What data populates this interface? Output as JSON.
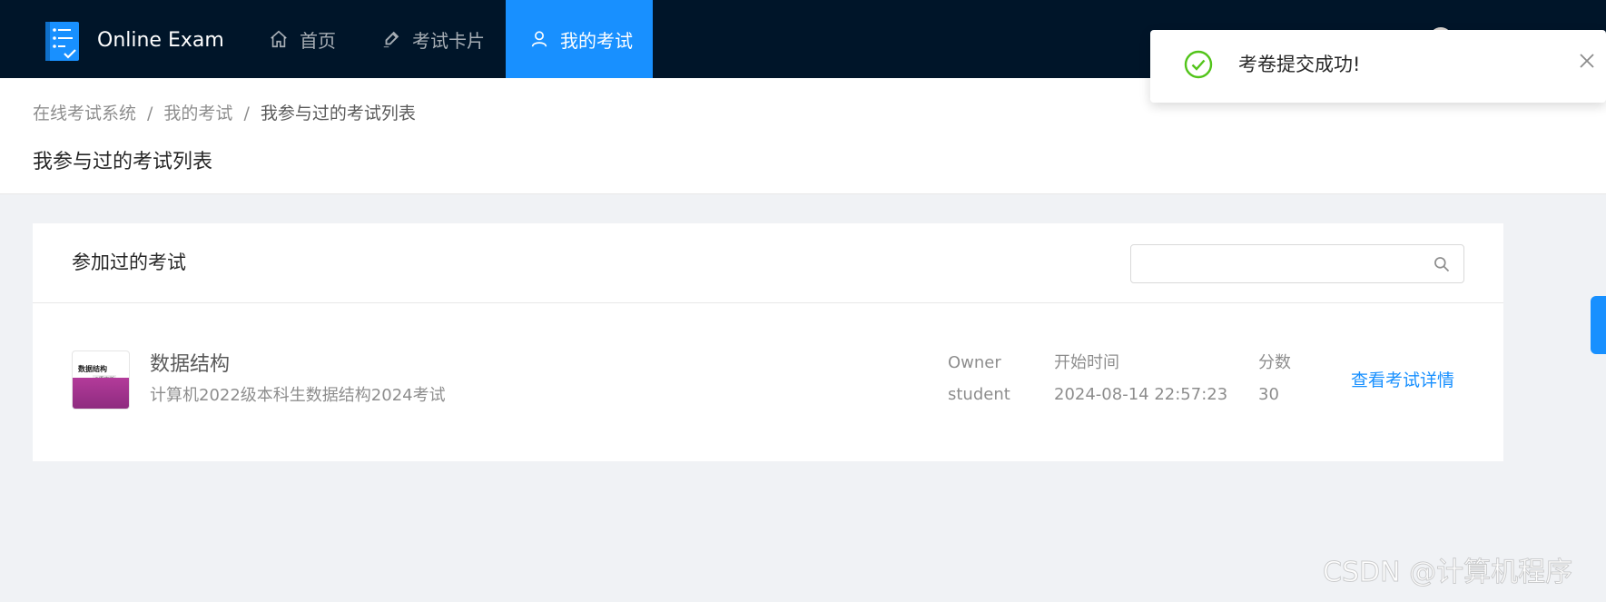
{
  "header": {
    "brand": "Online Exam",
    "nav": [
      {
        "label": "首页",
        "icon": "home-icon"
      },
      {
        "label": "考试卡片",
        "icon": "edit-icon"
      },
      {
        "label": "我的考试",
        "icon": "user-icon",
        "active": true
      }
    ],
    "colors": {
      "bg": "#001529",
      "active": "#1890ff"
    }
  },
  "page_header": {
    "breadcrumb": [
      "在线考试系统",
      "我的考试",
      "我参与过的考试列表"
    ],
    "separator": "/",
    "title": "我参与过的考试列表"
  },
  "card": {
    "title": "参加过的考试",
    "search": {
      "value": "",
      "placeholder": ""
    },
    "items": [
      {
        "title": "数据结构",
        "description": "计算机2022级本科生数据结构2024考试",
        "owner_label": "Owner",
        "owner": "student",
        "time_label": "开始时间",
        "time": "2024-08-14 22:57:23",
        "score_label": "分数",
        "score": "30",
        "action": "查看考试详情",
        "cover": {
          "title": "数据结构",
          "tag": "C语言版"
        }
      }
    ]
  },
  "notification": {
    "type": "success",
    "message": "考卷提交成功!",
    "color": "#52c41a"
  },
  "watermark": "CSDN @计算机程序"
}
